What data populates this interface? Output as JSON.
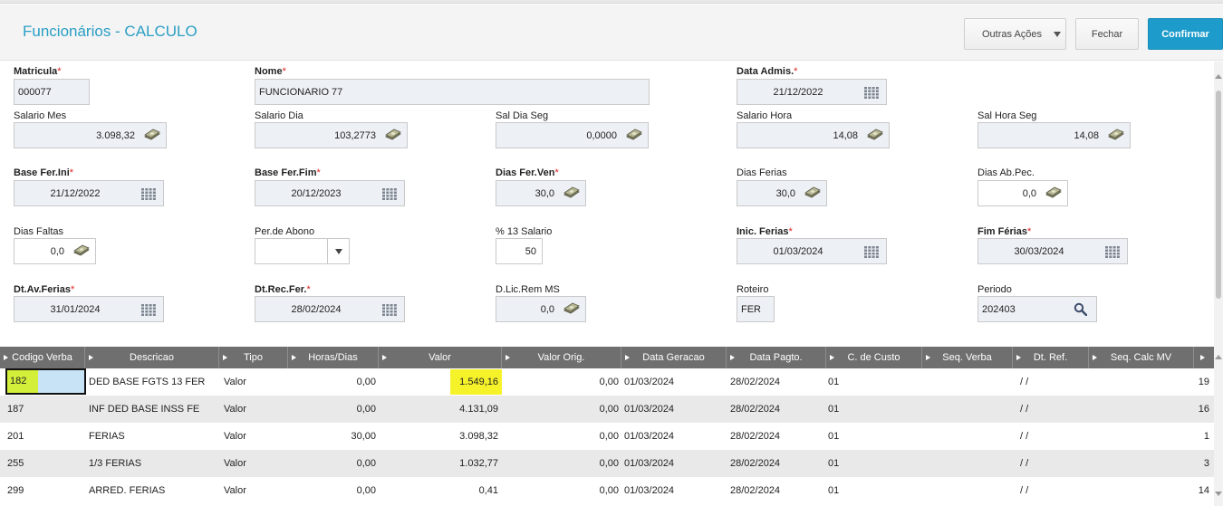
{
  "header": {
    "title": "Funcionários - CALCULO",
    "buttons": {
      "other_actions": "Outras Ações",
      "close": "Fechar",
      "confirm": "Confirmar"
    }
  },
  "fields": {
    "matricula": {
      "label": "Matricula",
      "required": "*",
      "value": "000077"
    },
    "nome": {
      "label": "Nome",
      "required": "*",
      "value": "FUNCIONARIO 77"
    },
    "data_admis": {
      "label": "Data Admis.",
      "required": "*",
      "value": "21/12/2022"
    },
    "salario_mes": {
      "label": "Salario Mes",
      "value": "3.098,32"
    },
    "salario_dia": {
      "label": "Salario Dia",
      "value": "103,2773"
    },
    "sal_dia_seg": {
      "label": "Sal Dia Seg",
      "value": "0,0000"
    },
    "salario_hora": {
      "label": "Salario Hora",
      "value": "14,08"
    },
    "sal_hora_seg": {
      "label": "Sal Hora Seg",
      "value": "14,08"
    },
    "base_fer_ini": {
      "label": "Base Fer.Ini",
      "required": "*",
      "value": "21/12/2022"
    },
    "base_fer_fim": {
      "label": "Base Fer.Fim",
      "required": "*",
      "value": "20/12/2023"
    },
    "dias_fer_ven": {
      "label": "Dias Fer.Ven",
      "required": "*",
      "value": "30,0"
    },
    "dias_ferias": {
      "label": "Dias Ferias",
      "value": "30,0"
    },
    "dias_ab_pec": {
      "label": "Dias Ab.Pec.",
      "value": "0,0"
    },
    "dias_faltas": {
      "label": "Dias Faltas",
      "value": "0,0"
    },
    "per_abono": {
      "label": "Per.de Abono",
      "value": ""
    },
    "pct_13_salario": {
      "label": "% 13 Salario",
      "value": "50"
    },
    "inic_ferias": {
      "label": "Inic. Ferias",
      "required": "*",
      "value": "01/03/2024"
    },
    "fim_ferias": {
      "label": "Fim Férias",
      "required": "*",
      "value": "30/03/2024"
    },
    "dt_av_ferias": {
      "label": "Dt.Av.Ferias",
      "required": "*",
      "value": "31/01/2024"
    },
    "dt_rec_fer": {
      "label": "Dt.Rec.Fer.",
      "required": "*",
      "value": "28/02/2024"
    },
    "d_lic_rem_ms": {
      "label": "D.Lic.Rem MS",
      "value": "0,0"
    },
    "roteiro": {
      "label": "Roteiro",
      "value": "FER"
    },
    "periodo": {
      "label": "Periodo",
      "value": "202403"
    }
  },
  "grid": {
    "columns": [
      "Codigo Verba",
      "Descricao",
      "Tipo",
      "Horas/Dias",
      "Valor",
      "Valor Orig.",
      "Data Geracao",
      "Data Pagto.",
      "C. de Custo",
      "Seq. Verba",
      "Dt. Ref.",
      "Seq. Calc MV"
    ],
    "rows": [
      {
        "codigo": "182",
        "descricao": "DED BASE FGTS 13 FER",
        "tipo": "Valor",
        "horas": "0,00",
        "valor": "1.549,16",
        "valor_orig": "0,00",
        "data_geracao": "01/03/2024",
        "data_pagto": "28/02/2024",
        "c_custo": "01",
        "seq_verba": "",
        "dt_ref": " / /",
        "seq_calc": "19"
      },
      {
        "codigo": "187",
        "descricao": "INF DED BASE INSS FE",
        "tipo": "Valor",
        "horas": "0,00",
        "valor": "4.131,09",
        "valor_orig": "0,00",
        "data_geracao": "01/03/2024",
        "data_pagto": "28/02/2024",
        "c_custo": "01",
        "seq_verba": "",
        "dt_ref": " / /",
        "seq_calc": "16"
      },
      {
        "codigo": "201",
        "descricao": "FERIAS",
        "tipo": "Valor",
        "horas": "30,00",
        "valor": "3.098,32",
        "valor_orig": "0,00",
        "data_geracao": "01/03/2024",
        "data_pagto": "28/02/2024",
        "c_custo": "01",
        "seq_verba": "",
        "dt_ref": " / /",
        "seq_calc": "1"
      },
      {
        "codigo": "255",
        "descricao": "1/3 FERIAS",
        "tipo": "Valor",
        "horas": "0,00",
        "valor": "1.032,77",
        "valor_orig": "0,00",
        "data_geracao": "01/03/2024",
        "data_pagto": "28/02/2024",
        "c_custo": "01",
        "seq_verba": "",
        "dt_ref": " / /",
        "seq_calc": "3"
      },
      {
        "codigo": "299",
        "descricao": "ARRED. FERIAS",
        "tipo": "Valor",
        "horas": "0,00",
        "valor": "0,41",
        "valor_orig": "0,00",
        "data_geracao": "01/03/2024",
        "data_pagto": "28/02/2024",
        "c_custo": "01",
        "seq_verba": "",
        "dt_ref": " / /",
        "seq_calc": "14"
      }
    ]
  }
}
